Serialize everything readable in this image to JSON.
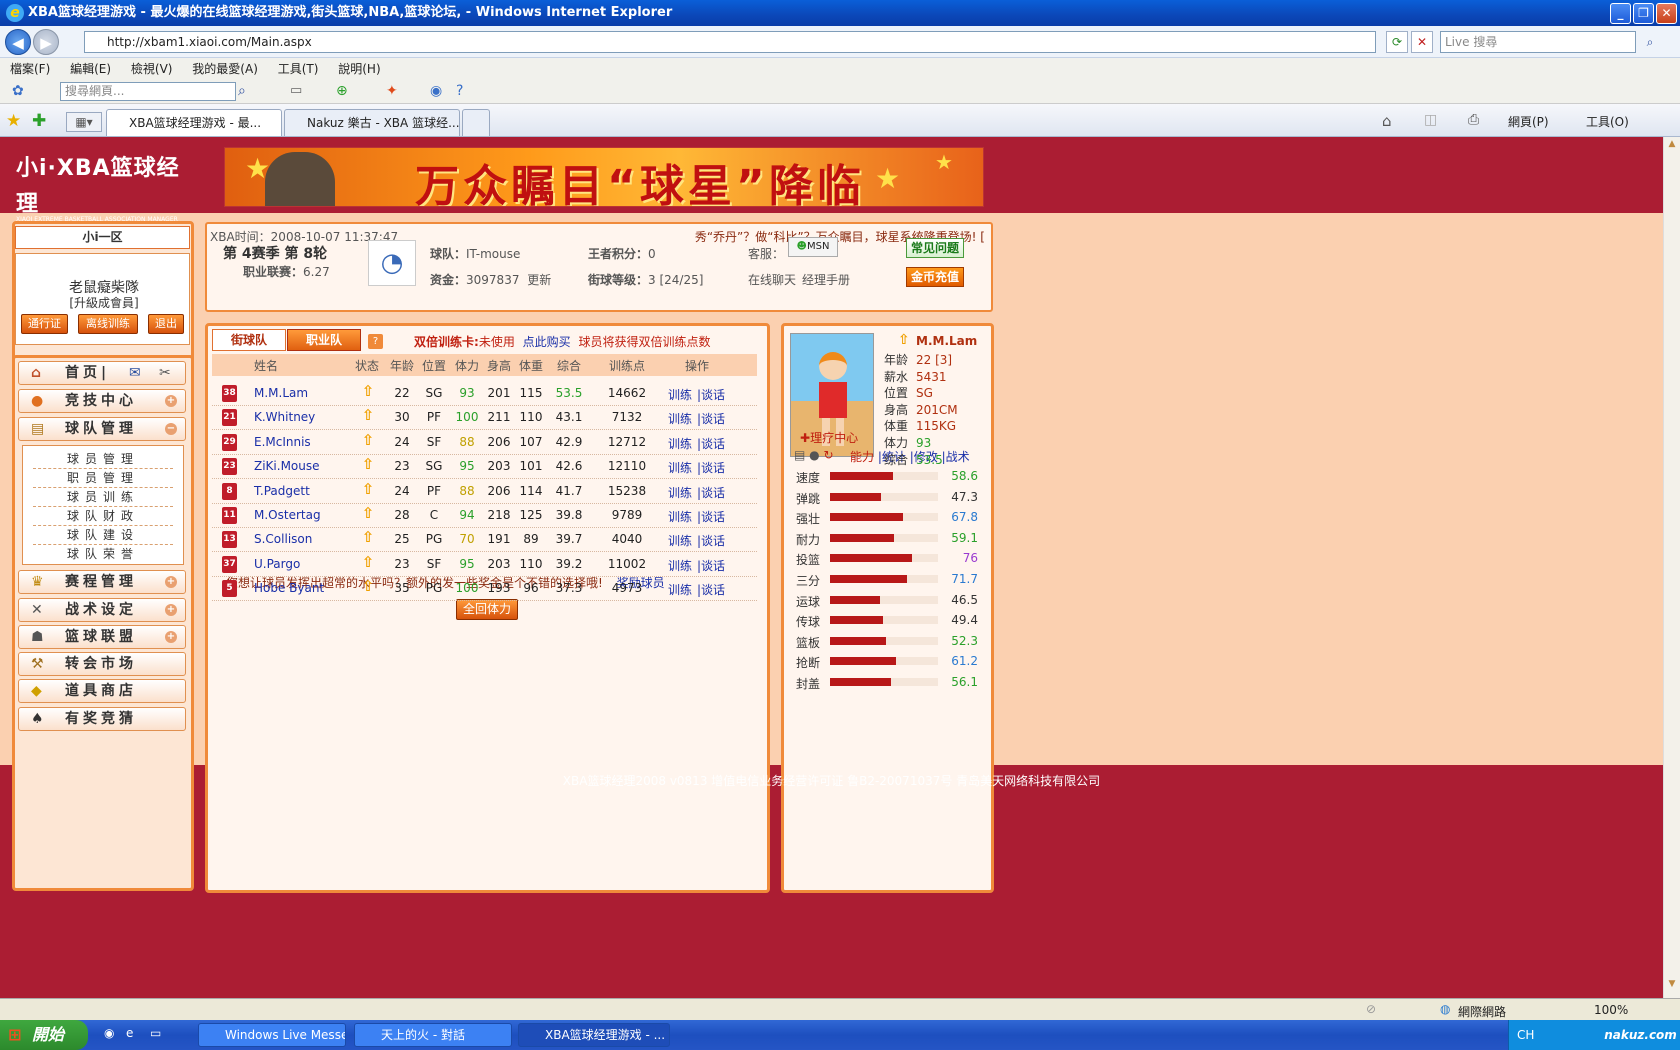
{
  "window": {
    "title": "XBA篮球经理游戏 - 最火爆的在线篮球经理游戏,街头篮球,NBA,篮球论坛, - Windows Internet Explorer"
  },
  "address": {
    "url": "http://xbam1.xiaoi.com/Main.aspx",
    "search_placeholder": "Live 搜尋"
  },
  "menu": [
    "檔案(F)",
    "編輯(E)",
    "檢視(V)",
    "我的最愛(A)",
    "工具(T)",
    "說明(H)"
  ],
  "toolbar": {
    "search_placeholder": "搜尋網頁..."
  },
  "tabs": [
    {
      "label": "XBA篮球经理游戏 - 最..."
    },
    {
      "label": "Nakuz 樂古 - XBA 篮球经..."
    }
  ],
  "command_bar": {
    "page": "網頁(P)",
    "tools": "工具(O)"
  },
  "site": {
    "logo": "小i·XBA篮球经理",
    "logo_sub": "XIAOI EXTREME BASKETBALL ASSOCIATION MANAGER",
    "banner": "万众瞩目“球星”降临"
  },
  "user": {
    "zone": "小i一区",
    "name": "老鼠癡柴隊",
    "level": "[升級成會員]",
    "buttons": [
      "通行证",
      "离线训练",
      "退出"
    ]
  },
  "nav": {
    "home": "首页|",
    "items": [
      "竞技中心",
      "球队管理",
      "赛程管理",
      "战术设定",
      "篮球联盟",
      "转会市场",
      "道具商店",
      "有奖竞猜"
    ],
    "sub_items": [
      "球员管理",
      "职员管理",
      "球员训练",
      "球队财政",
      "球队建设",
      "球队荣誉"
    ]
  },
  "info": {
    "time_label": "XBA时间：",
    "time": "2008-10-07 11:37:47",
    "ticker": "秀“乔丹”？做“科比”？万众瞩目，球星系统隆重登场! [",
    "season": "第 4赛季 第 8轮",
    "league_label": "职业联赛：",
    "league": "6.27",
    "team_label": "球队：",
    "team": "IT-mouse",
    "funds_label": "资金：",
    "funds": "3097837",
    "update": "更新",
    "king_label": "王者积分：",
    "king": "0",
    "street_label": "街球等级：",
    "street": "3 [24/25]",
    "service_label": "客服：",
    "msn": "MSN",
    "chat": "在线聊天",
    "manual": "经理手册",
    "faq": "常见问题",
    "recharge": "金币充值"
  },
  "team_panel": {
    "tabs": [
      "街球队",
      "职业队"
    ],
    "notice_label": "双倍训练卡:",
    "notice_status": "未使用",
    "buy_link": "点此购买",
    "notice_tail": "球员将获得双倍训练点数",
    "columns": [
      "姓名",
      "状态",
      "年龄",
      "位置",
      "体力",
      "身高",
      "体重",
      "综合",
      "训练点",
      "操作"
    ],
    "players": [
      {
        "num": "38",
        "name": "M.M.Lam",
        "age": "22",
        "pos": "SG",
        "sta": "93",
        "h": "201",
        "w": "115",
        "ovr": "53.5",
        "tp": "14662"
      },
      {
        "num": "21",
        "name": "K.Whitney",
        "age": "30",
        "pos": "PF",
        "sta": "100",
        "h": "211",
        "w": "110",
        "ovr": "43.1",
        "tp": "7132"
      },
      {
        "num": "29",
        "name": "E.McInnis",
        "age": "24",
        "pos": "SF",
        "sta": "88",
        "h": "206",
        "w": "107",
        "ovr": "42.9",
        "tp": "12712"
      },
      {
        "num": "23",
        "name": "ZiKi.Mouse",
        "age": "23",
        "pos": "SG",
        "sta": "95",
        "h": "203",
        "w": "101",
        "ovr": "42.6",
        "tp": "12110"
      },
      {
        "num": "8",
        "name": "T.Padgett",
        "age": "24",
        "pos": "PF",
        "sta": "88",
        "h": "206",
        "w": "114",
        "ovr": "41.7",
        "tp": "15238"
      },
      {
        "num": "11",
        "name": "M.Ostertag",
        "age": "28",
        "pos": "C",
        "sta": "94",
        "h": "218",
        "w": "125",
        "ovr": "39.8",
        "tp": "9789"
      },
      {
        "num": "13",
        "name": "S.Collison",
        "age": "25",
        "pos": "PG",
        "sta": "70",
        "h": "191",
        "w": "89",
        "ovr": "39.7",
        "tp": "4040"
      },
      {
        "num": "37",
        "name": "U.Pargo",
        "age": "23",
        "pos": "SF",
        "sta": "95",
        "h": "203",
        "w": "110",
        "ovr": "39.2",
        "tp": "11002"
      },
      {
        "num": "5",
        "name": "Hobe Byant",
        "age": "35",
        "pos": "PG",
        "sta": "100",
        "h": "193",
        "w": "96",
        "ovr": "37.3",
        "tp": "4973"
      }
    ],
    "action_train": "训练",
    "action_talk": "|谈话",
    "bonus_text": "您想让球员发挥出超常的水平吗？额外的发一些奖金是个不错的选择哦!",
    "bonus_link": "奖励球员",
    "restore_button": "全回体力"
  },
  "player_card": {
    "name": "M.M.Lam",
    "fields": [
      {
        "label": "年龄",
        "value": "22 [3]"
      },
      {
        "label": "薪水",
        "value": "5431"
      },
      {
        "label": "位置",
        "value": "SG"
      },
      {
        "label": "身高",
        "value": "201CM"
      },
      {
        "label": "体重",
        "value": "115KG"
      },
      {
        "label": "体力",
        "value": "93"
      },
      {
        "label": "综合",
        "value": "53.5"
      }
    ],
    "therapy": "理疗中心",
    "links": [
      "能力",
      "|统计",
      "|修改",
      "|战术"
    ],
    "stats": [
      {
        "label": "速度",
        "value": "58.6",
        "color": "#2aa02a"
      },
      {
        "label": "弹跳",
        "value": "47.3",
        "color": "#333333"
      },
      {
        "label": "强壮",
        "value": "67.8",
        "color": "#2a7ad0"
      },
      {
        "label": "耐力",
        "value": "59.1",
        "color": "#2aa02a"
      },
      {
        "label": "投篮",
        "value": "76",
        "color": "#9a3ad0"
      },
      {
        "label": "三分",
        "value": "71.7",
        "color": "#2a7ad0"
      },
      {
        "label": "运球",
        "value": "46.5",
        "color": "#333333"
      },
      {
        "label": "传球",
        "value": "49.4",
        "color": "#333333"
      },
      {
        "label": "篮板",
        "value": "52.3",
        "color": "#2aa02a"
      },
      {
        "label": "抢断",
        "value": "61.2",
        "color": "#2a7ad0"
      },
      {
        "label": "封盖",
        "value": "56.1",
        "color": "#2aa02a"
      }
    ]
  },
  "footer": "XBA篮球经理2008 v0813   增值电信业务经营许可证  鲁B2-20071037号  青岛美天网络科技有限公司",
  "status": {
    "zone": "網際網路",
    "zoom": "100%"
  },
  "taskbar": {
    "start": "開始",
    "tasks": [
      "Windows Live Messen...",
      "天上的火 - 對話",
      "XBA篮球经理游戏 - ..."
    ],
    "tray": "CH",
    "watermark": "nakuz.com"
  }
}
